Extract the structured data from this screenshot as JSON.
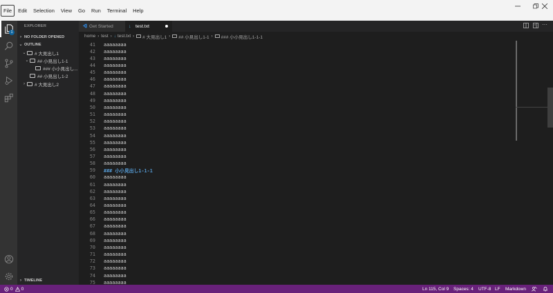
{
  "menu": [
    "File",
    "Edit",
    "Selection",
    "View",
    "Go",
    "Run",
    "Terminal",
    "Help"
  ],
  "window_controls": [
    "minimize-icon",
    "restore-icon",
    "close-icon"
  ],
  "activity_bar": {
    "items": [
      "explorer-icon",
      "search-icon",
      "source-control-icon",
      "run-debug-icon",
      "extensions-icon"
    ],
    "bottom": [
      "account-icon",
      "settings-gear-icon"
    ],
    "badge": "1"
  },
  "sidebar": {
    "title": "EXPLORER",
    "no_folder": "NO FOLDER OPENED",
    "outline_title": "OUTLINE",
    "outline": [
      {
        "label": "# 大見出し1",
        "level": 0,
        "twisty": "v"
      },
      {
        "label": "## 小見出し1-1",
        "level": 1,
        "twisty": "v"
      },
      {
        "label": "### 小小見出し...",
        "level": 2,
        "twisty": ""
      },
      {
        "label": "## 小見出し1-2",
        "level": 1,
        "twisty": ""
      },
      {
        "label": "# 大見出し2",
        "level": 0,
        "twisty": ">"
      }
    ],
    "timeline_title": "TIMELINE"
  },
  "tabs": [
    {
      "label": "Get Started",
      "active": false,
      "icon": "vscode-logo-icon"
    },
    {
      "label": "test.txt",
      "active": true,
      "icon": "markdown-file-icon",
      "dirty": true
    }
  ],
  "breadcrumb": [
    "home",
    "test",
    "test.txt",
    "# 大見出し1",
    "## 小見出し1-1",
    "### 小小見出し1-1-1"
  ],
  "editor": {
    "first_line": 41,
    "lines": [
      "aaaaaaaa",
      "aaaaaaaa",
      "aaaaaaaa",
      "aaaaaaaa",
      "aaaaaaaa",
      "aaaaaaaa",
      "aaaaaaaa",
      "aaaaaaaa",
      "aaaaaaaa",
      "aaaaaaaa",
      "aaaaaaaa",
      "aaaaaaaa",
      "aaaaaaaa",
      "aaaaaaaa",
      "aaaaaaaa",
      "aaaaaaaa",
      "aaaaaaaa",
      "aaaaaaaa",
      "### 小小見出し1-1-1",
      "aaaaaaaa",
      "aaaaaaaa",
      "aaaaaaaa",
      "aaaaaaaa",
      "aaaaaaaa",
      "aaaaaaaa",
      "aaaaaaaa",
      "aaaaaaaa",
      "aaaaaaaa",
      "aaaaaaaa",
      "aaaaaaaa",
      "aaaaaaaa",
      "aaaaaaaa",
      "aaaaaaaa",
      "aaaaaaaa",
      "aaaaaaaa",
      "aaaaaaaa"
    ]
  },
  "status": {
    "errors": "0",
    "warnings": "0",
    "position": "Ln 115, Col 9",
    "spaces": "Spaces: 4",
    "encoding": "UTF-8",
    "eol": "LF",
    "language": "Markdown"
  },
  "colors": {
    "status_bar": "#68217a",
    "heading": "#569cd6",
    "editor_bg": "#1e1e1e"
  }
}
